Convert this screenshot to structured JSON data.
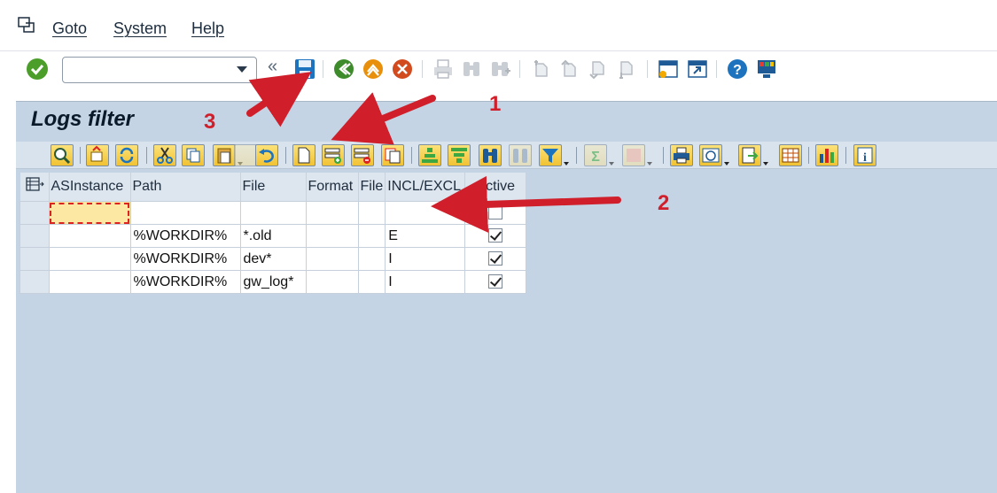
{
  "menubar": {
    "items": [
      {
        "label": "Goto"
      },
      {
        "label": "System"
      },
      {
        "label": "Help"
      }
    ]
  },
  "systoolbar": {
    "command_field_value": "",
    "collapse_glyph": "«",
    "icons": [
      "enter-icon",
      "save-icon",
      "back-icon",
      "exit-icon",
      "cancel-icon",
      "print-icon",
      "find-icon",
      "find-next-icon",
      "first-page-icon",
      "previous-page-icon",
      "next-page-icon",
      "last-page-icon",
      "create-session-icon",
      "shortcut-icon",
      "help-icon",
      "customize-layout-icon"
    ]
  },
  "screen": {
    "title": "Logs filter"
  },
  "alv_toolbar": {
    "buttons": [
      "details",
      "check",
      "refresh",
      "cut",
      "copy",
      "paste",
      "undo",
      "append-row",
      "insert-row",
      "delete-row",
      "duplicate-row",
      "sort-ascending",
      "sort-descending",
      "find",
      "find-next",
      "filter",
      "total",
      "subtotal",
      "print",
      "views",
      "export",
      "change-layout",
      "graphic",
      "information"
    ]
  },
  "grid": {
    "columns": [
      "ASInstance",
      "Path",
      "File",
      "Format",
      "File",
      "INCL/EXCL",
      "Active"
    ],
    "rows": [
      {
        "asinstance": "",
        "path": "",
        "file": "",
        "format": "",
        "file2": "",
        "incl_excl": "",
        "active": false
      },
      {
        "asinstance": "",
        "path": "%WORKDIR%",
        "file": "*.old",
        "format": "",
        "file2": "",
        "incl_excl": "E",
        "active": true
      },
      {
        "asinstance": "",
        "path": "%WORKDIR%",
        "file": "dev*",
        "format": "",
        "file2": "",
        "incl_excl": "I",
        "active": true
      },
      {
        "asinstance": "",
        "path": "%WORKDIR%",
        "file": "gw_log*",
        "format": "",
        "file2": "",
        "incl_excl": "I",
        "active": true
      }
    ]
  },
  "annotations": {
    "labels": [
      "1",
      "2",
      "3"
    ],
    "color": "#d01f2a"
  },
  "colors": {
    "app_background": "#c4d4e5",
    "button_yellow": "#f1c232",
    "current_cell": "#fce8a2"
  }
}
